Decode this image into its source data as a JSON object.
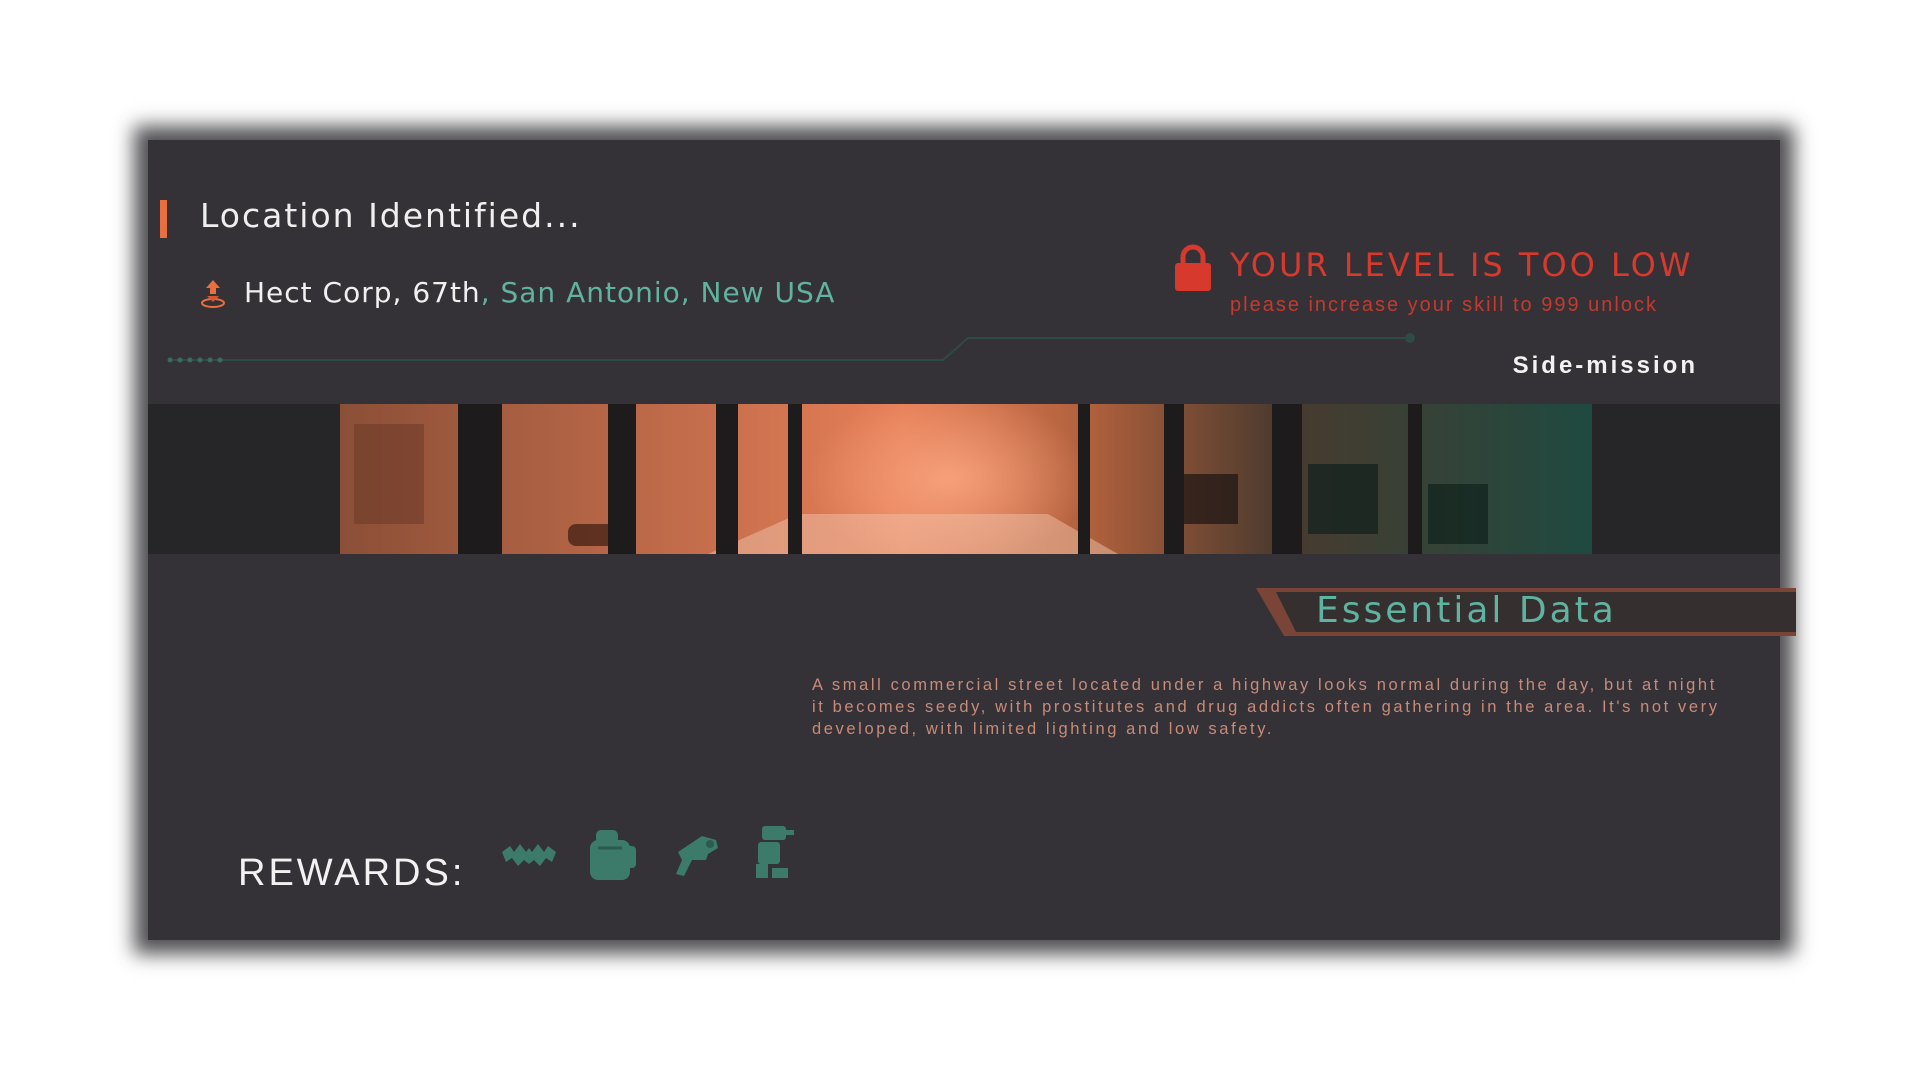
{
  "header": {
    "title": "Location Identified...",
    "location_name": "Hect Corp, 67th",
    "location_city": ", San Antonio, New USA",
    "location_icon": "location-pin-icon"
  },
  "lock": {
    "icon": "lock-icon",
    "title": "YOUR LEVEL IS TOO LOW",
    "subtitle": "please increase your skill to 999 unlock"
  },
  "mission_type": "Side-mission",
  "banner": {
    "image": "office-interior-panorama"
  },
  "essential": {
    "label": "Essential Data",
    "description": "A small commercial street located under a highway looks normal during the day, but at night it becomes seedy, with prostitutes and drug addicts often gathering in the area. It's not very developed, with limited lighting and low safety."
  },
  "rewards": {
    "label": "REWARDS:",
    "items": [
      "bat-icon",
      "backpack-icon",
      "gun-icon",
      "robot-icon"
    ]
  },
  "colors": {
    "panel": "#343236",
    "accent_orange": "#e8703f",
    "accent_teal": "#5fb3a0",
    "warning_red": "#d7392d",
    "description_text": "#c98a78"
  }
}
